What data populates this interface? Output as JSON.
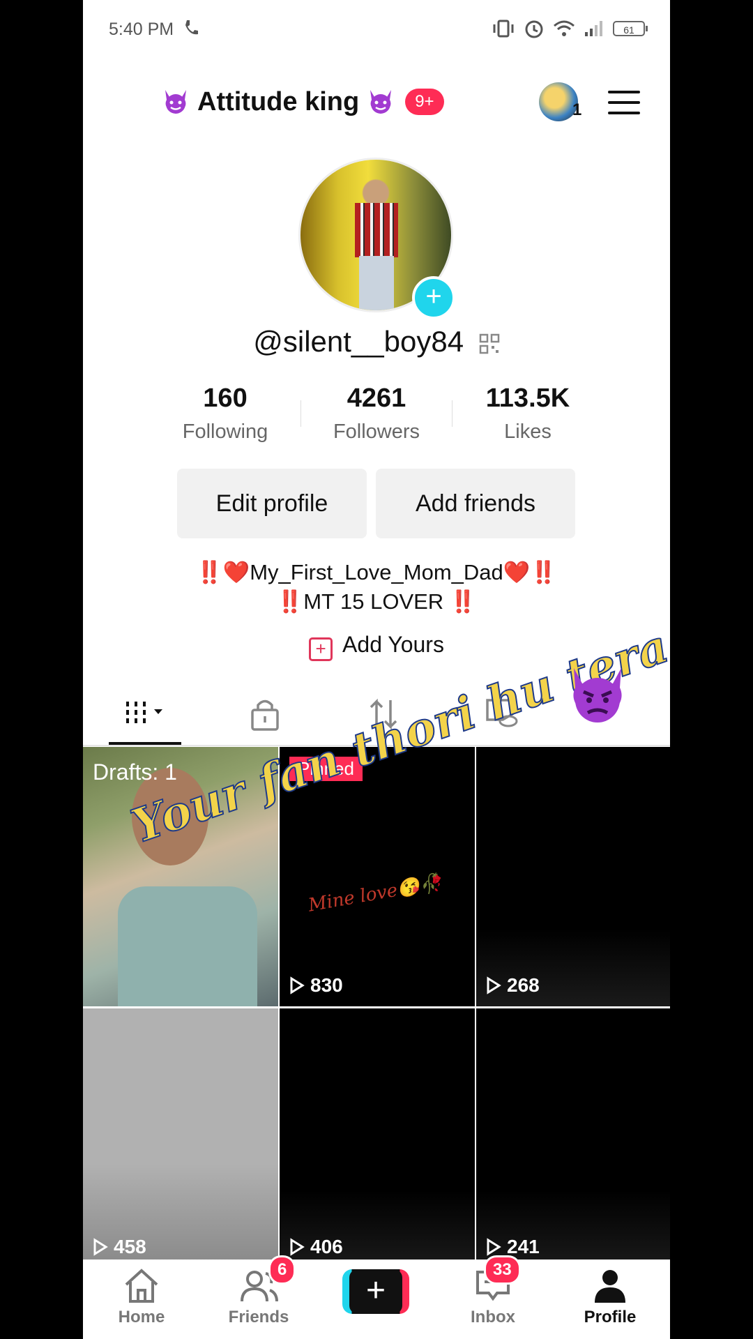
{
  "status_bar": {
    "time": "5:40 PM",
    "battery": "61"
  },
  "header": {
    "title": "Attitude king",
    "badge": "9+",
    "avatar_count": "1"
  },
  "profile": {
    "username": "@silent__boy84",
    "stats": [
      {
        "value": "160",
        "label": "Following"
      },
      {
        "value": "4261",
        "label": "Followers"
      },
      {
        "value": "113.5K",
        "label": "Likes"
      }
    ],
    "buttons": {
      "edit": "Edit profile",
      "add_friends": "Add friends"
    },
    "bio_line1": "‼️❤️My_First_Love_Mom_Dad❤️‼️",
    "bio_line2": "‼️MT 15 LOVER ‼️",
    "add_yours": "Add Yours"
  },
  "grid": {
    "drafts": "Drafts: 1",
    "pinned": "Pinned",
    "pinned_caption": "Mine love😘🥀",
    "views": [
      "830",
      "268",
      "458",
      "406",
      "241"
    ]
  },
  "overlay": {
    "text": "Your fan thori hu tera"
  },
  "nav": {
    "items": [
      {
        "label": "Home"
      },
      {
        "label": "Friends",
        "badge": "6"
      },
      {
        "label": "Inbox",
        "badge": "33"
      },
      {
        "label": "Profile"
      }
    ]
  },
  "colors": {
    "accent": "#fe2c55",
    "teal": "#20d5ec",
    "overlay_text": "#f3d34a"
  }
}
